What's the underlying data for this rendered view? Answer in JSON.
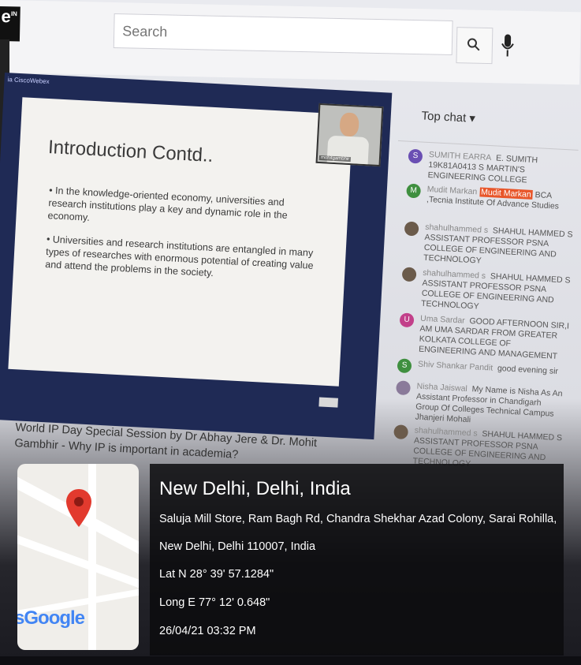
{
  "browser": {
    "logo_fragment": "e",
    "logo_sup": "IN",
    "search_placeholder": "Search"
  },
  "player": {
    "app_tag": "ia CiscoWebex",
    "slide_title": "Introduction Contd..",
    "bullet_1": "• In the knowledge-oriented economy, universities and research institutions play a key and dynamic role in the economy.",
    "bullet_2": "• Universities and research institutions are entangled in many types of researches with enormous potential of creating value and attend the problems in the society.",
    "presenter_label": "mohitgambhir"
  },
  "video_title": "World IP Day Special Session by Dr Abhay Jere & Dr. Mohit Gambhir - Why IP is important in academia?",
  "chat": {
    "header": "Top chat ▾",
    "messages": [
      {
        "initial": "S",
        "color": "#6a4fb3",
        "author": "SUMITH EARRA",
        "text": "E. SUMITH 19K81A0413 S MARTIN'S ENGINEERING COLLEGE"
      },
      {
        "initial": "M",
        "color": "#3f8f3f",
        "author": "Mudit Markan",
        "badge": "Mudit Markan",
        "text": "BCA ,Tecnia Institute Of Advance Studies"
      },
      {
        "initial": "",
        "color": "#6b5b4b",
        "author": "shahulhammed s",
        "text": "SHAHUL HAMMED S ASSISTANT PROFESSOR PSNA COLLEGE OF ENGINEERING AND TECHNOLOGY"
      },
      {
        "initial": "",
        "color": "#6b5b4b",
        "author": "shahulhammed s",
        "text": "SHAHUL HAMMED S ASSISTANT PROFESSOR PSNA COLLEGE OF ENGINEERING AND TECHNOLOGY"
      },
      {
        "initial": "U",
        "color": "#c2408a",
        "author": "Uma Sardar",
        "text": "GOOD AFTERNOON SIR,I AM UMA SARDAR FROM GREATER KOLKATA COLLEGE OF ENGINEERING AND MANAGEMENT"
      },
      {
        "initial": "S",
        "color": "#3f8f3f",
        "author": "Shiv Shankar Pandit",
        "text": "good evening sir"
      },
      {
        "initial": "",
        "color": "#8a7a9a",
        "author": "Nisha Jaiswal",
        "text": "My Name is Nisha As An Assistant Professor in Chandigarh Group Of Colleges Technical Campus Jhanjeri Mohali"
      },
      {
        "initial": "",
        "color": "#6b5b4b",
        "author": "shahulhammed s",
        "text": "SHAHUL HAMMED S ASSISTANT PROFESSOR PSNA COLLEGE OF ENGINEERING AND TECHNOLOGY"
      }
    ]
  },
  "location": {
    "title": "New Delhi, Delhi, India",
    "address_1": "Saluja Mill Store, Ram Bagh Rd, Chandra Shekhar Azad Colony, Sarai Rohilla,",
    "address_2": "New Delhi, Delhi 110007, India",
    "lat": "Lat N 28° 39' 57.1284\"",
    "long": "Long E 77° 12' 0.648\"",
    "datetime": "26/04/21 03:32 PM",
    "map_logo": "Google"
  }
}
